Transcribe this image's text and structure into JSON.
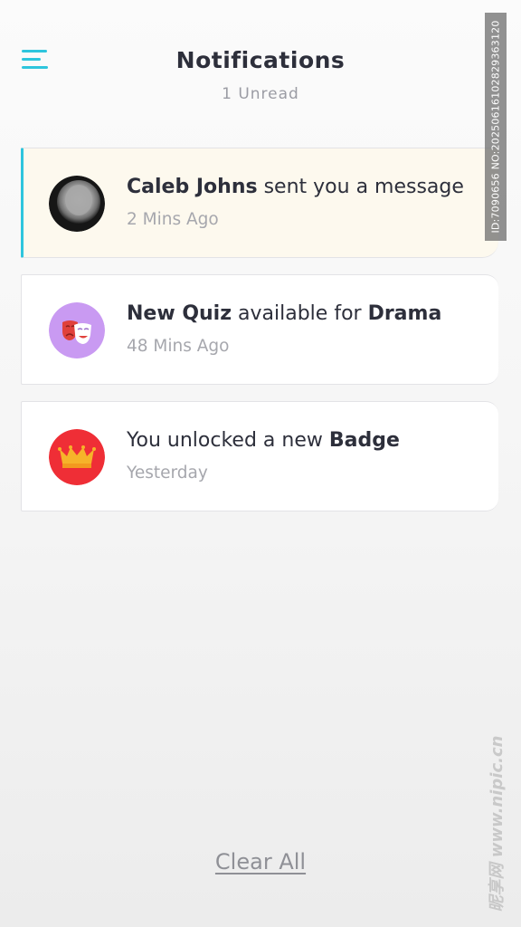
{
  "theme": {
    "accent": "#2ec5dd",
    "unread_bg": "#fdf9ee",
    "text_dark": "#2d2f3b",
    "text_muted": "#a6a7ad",
    "drama_bg": "#c99af2",
    "badge_bg": "#ef2e36",
    "crown_color": "#f6b32a"
  },
  "header": {
    "title": "Notifications",
    "subtitle": "1 Unread",
    "menu_icon": "hamburger-menu-icon"
  },
  "notifications": [
    {
      "unread": true,
      "icon": "user-avatar",
      "bold_1": "Caleb Johns",
      "text_1": " sent you a message",
      "time": "2 Mins Ago"
    },
    {
      "unread": false,
      "icon": "theater-masks-icon",
      "bold_1": "New Quiz",
      "text_1": " available for ",
      "bold_2": "Drama",
      "time": "48 Mins Ago"
    },
    {
      "unread": false,
      "icon": "crown-icon",
      "text_1": "You unlocked a new ",
      "bold_1": "Badge",
      "time": "Yesterday"
    }
  ],
  "footer": {
    "clear_all_label": "Clear All"
  },
  "watermarks": {
    "id_text": "ID:7090656 NO:20250616102829363120",
    "site_text": "昵享网 www.nipic.cn"
  }
}
